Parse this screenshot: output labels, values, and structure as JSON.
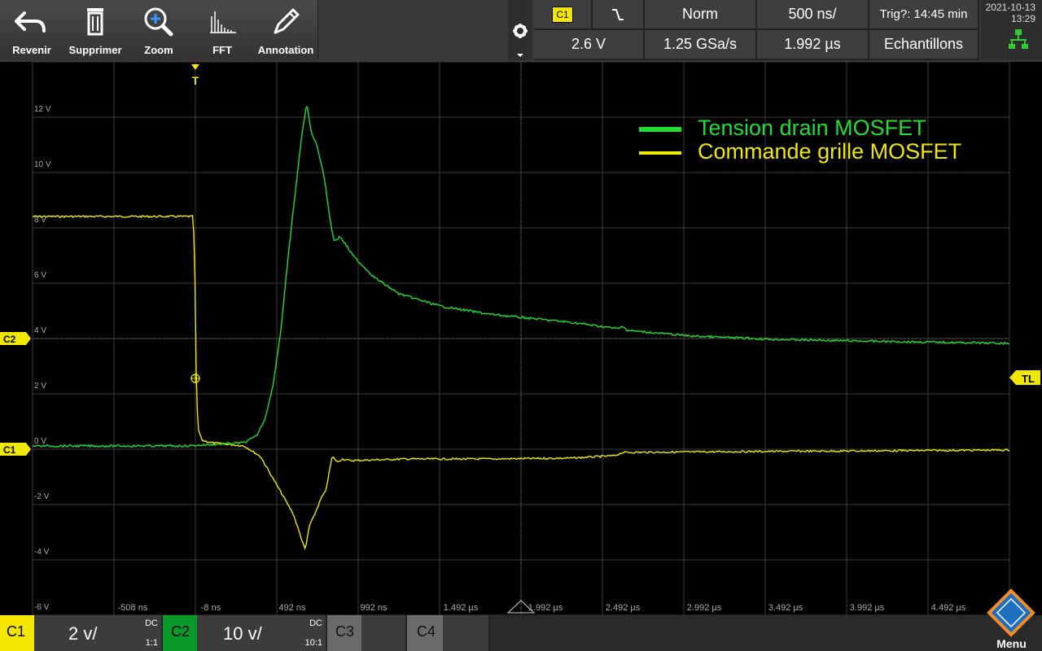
{
  "toolbar": {
    "undo_label": "Revenir",
    "delete_label": "Supprimer",
    "zoom_label": "Zoom",
    "fft_label": "FFT",
    "annotation_label": "Annotation"
  },
  "trigger": {
    "source": "C1",
    "mode": "Norm",
    "level": "2.6 V",
    "timebase": "500 ns/",
    "sample_rate": "1.25 GSa/s",
    "position": "1.992 µs",
    "trig_status": "Trig?: 14:45 min",
    "acquisition": "Echantillons"
  },
  "datetime": {
    "date": "2021-10-13",
    "time": "13:29"
  },
  "markers": {
    "trigger": "T",
    "c2": "C2",
    "c1": "C1",
    "tl": "TL"
  },
  "y_ticks": [
    "12 V",
    "10 V",
    "8 V",
    "6 V",
    "4 V",
    "2 V",
    "0 V",
    "-2 V",
    "-4 V",
    "-6 V"
  ],
  "x_ticks": [
    "-508 ns",
    "-8 ns",
    "492 ns",
    "992 ns",
    "1.492 µs",
    "1.992 µs",
    "2.492 µs",
    "2.992 µs",
    "3.492 µs",
    "3.992 µs",
    "4.492 µs"
  ],
  "legend": {
    "green_label": "Tension drain MOSFET",
    "yellow_label": "Commande grille MOSFET"
  },
  "channels": {
    "c1": {
      "label": "C1",
      "scale": "2 v/",
      "coupling": "DC",
      "probe": "1:1",
      "color": "#f5e600"
    },
    "c2": {
      "label": "C2",
      "scale": "10 v/",
      "coupling": "DC",
      "probe": "10:1",
      "color": "#0a9a2a"
    },
    "c3": {
      "label": "C3"
    },
    "c4": {
      "label": "C4"
    }
  },
  "menu_label": "Menu",
  "colors": {
    "green_trace": "#22dd33",
    "yellow_trace": "#f0e800",
    "grid": "#3c3c3c"
  }
}
